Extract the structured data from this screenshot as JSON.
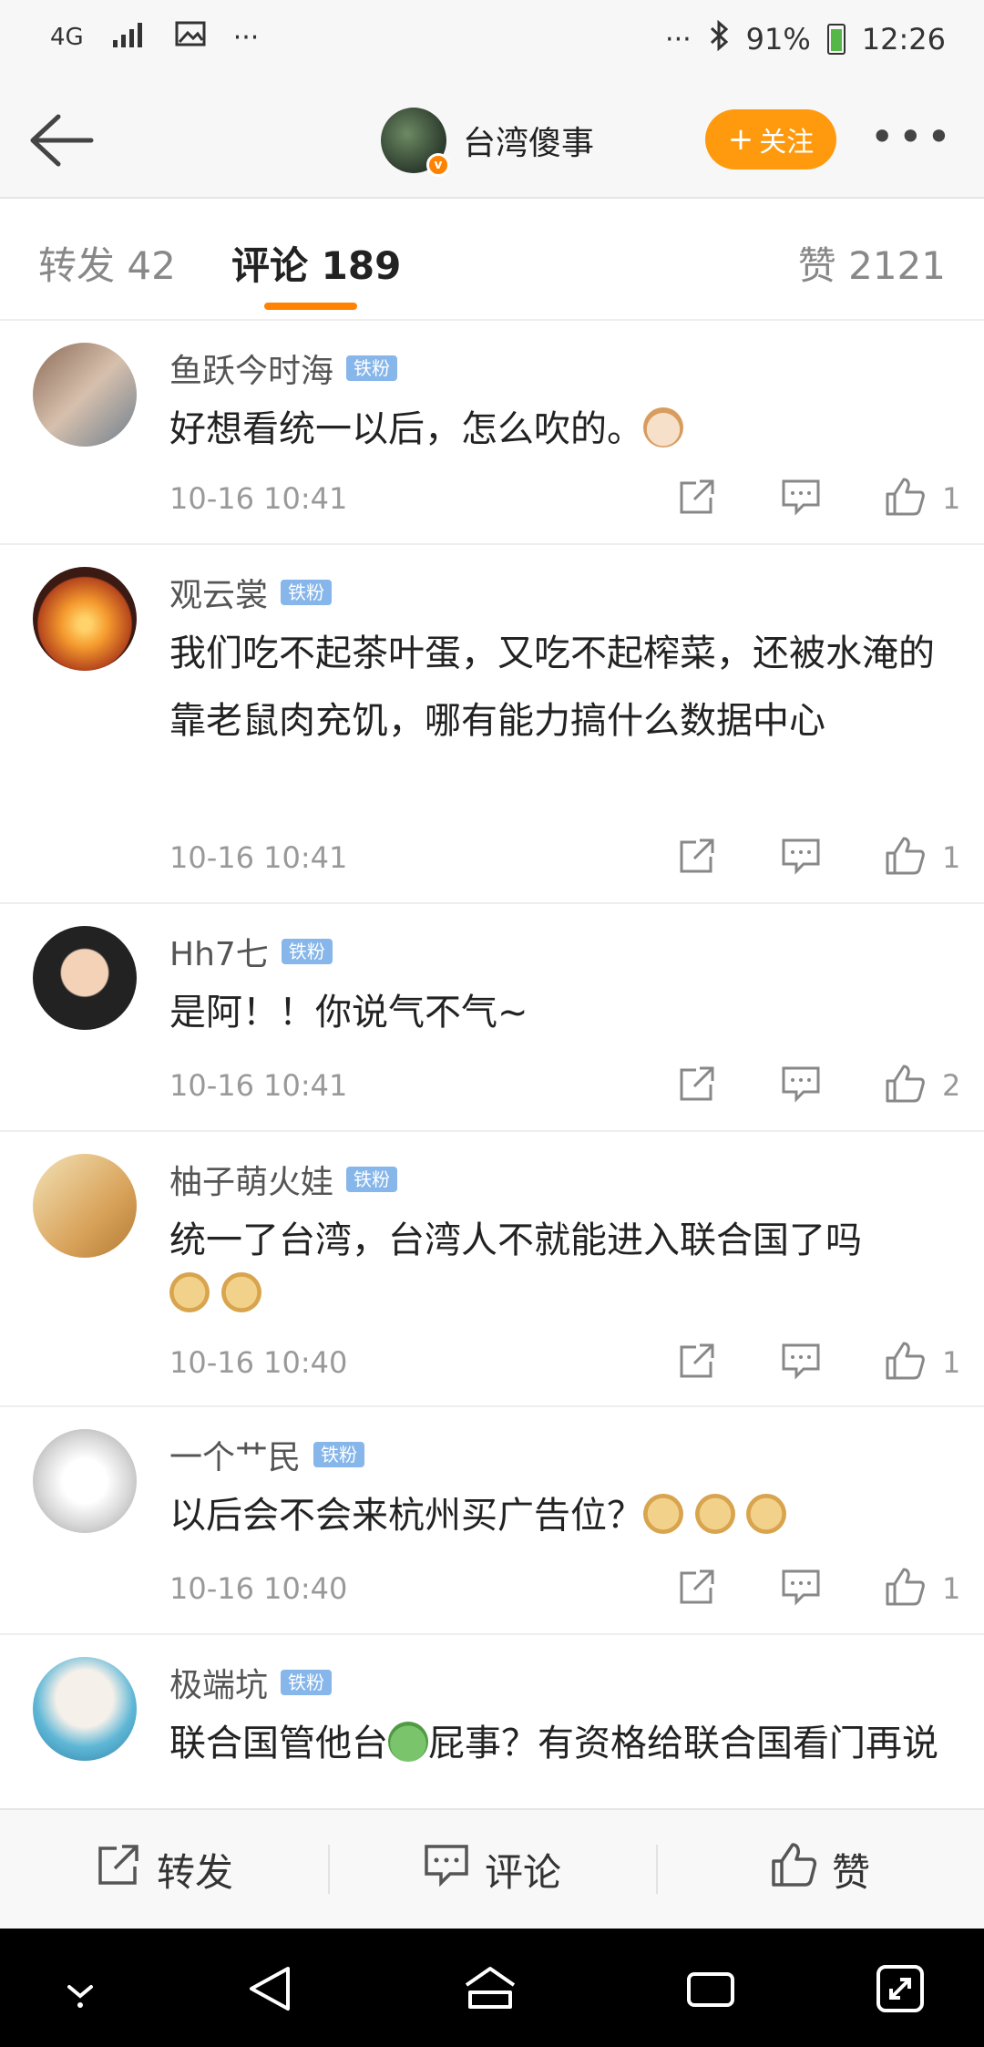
{
  "status_bar": {
    "network": "4G",
    "battery": "91%",
    "time": "12:26",
    "icons": [
      "signal-icon",
      "image-icon",
      "more-dots-icon",
      "bluetooth-icon",
      "battery-icon"
    ]
  },
  "header": {
    "account_name": "台湾傻事",
    "follow_label": "关注",
    "verified_mark": "v"
  },
  "tabs": [
    {
      "label": "转发 42",
      "active": false
    },
    {
      "label": "评论 189",
      "active": true
    },
    {
      "label": "赞 2121",
      "active": false
    }
  ],
  "comments": [
    {
      "user": "鱼跃今时海",
      "badge": "铁粉",
      "text": "好想看统一以后，怎么吹的。",
      "emojis": [
        "cat"
      ],
      "time": "10-16 10:41",
      "likes": "1"
    },
    {
      "user": "观云裳",
      "badge": "铁粉",
      "text": "我们吃不起茶叶蛋，又吃不起榨菜，还被水淹的靠老鼠肉充饥，哪有能力搞什么数据中心",
      "emojis": [],
      "time": "10-16 10:41",
      "likes": "1"
    },
    {
      "user": "Hh7七",
      "badge": "铁粉",
      "text": "是阿！！你说气不气~",
      "emojis": [],
      "time": "10-16 10:41",
      "likes": "2"
    },
    {
      "user": "柚子萌火娃",
      "badge": "铁粉",
      "text": "统一了台湾，台湾人不就能进入联合国了吗",
      "emojis": [
        "doge",
        "doge"
      ],
      "time": "10-16 10:40",
      "likes": "1"
    },
    {
      "user": "一个艹民",
      "badge": "铁粉",
      "text": "以后会不会来杭州买广告位？",
      "emojis": [
        "doge",
        "doge",
        "doge"
      ],
      "time": "10-16 10:40",
      "likes": "1"
    },
    {
      "user": "极端坑",
      "badge": "铁粉",
      "text_before": "联合国管他台",
      "text_after": "屁事？有资格给联合国看门再说",
      "emojis": [
        "frog"
      ],
      "time": "",
      "likes": ""
    }
  ],
  "bottom_bar": {
    "repost_label": "转发",
    "comment_label": "评论",
    "like_label": "赞"
  },
  "colors": {
    "accent": "#ff8200",
    "follow_button": "#ff9a0e",
    "badge": "#86b6ea"
  }
}
